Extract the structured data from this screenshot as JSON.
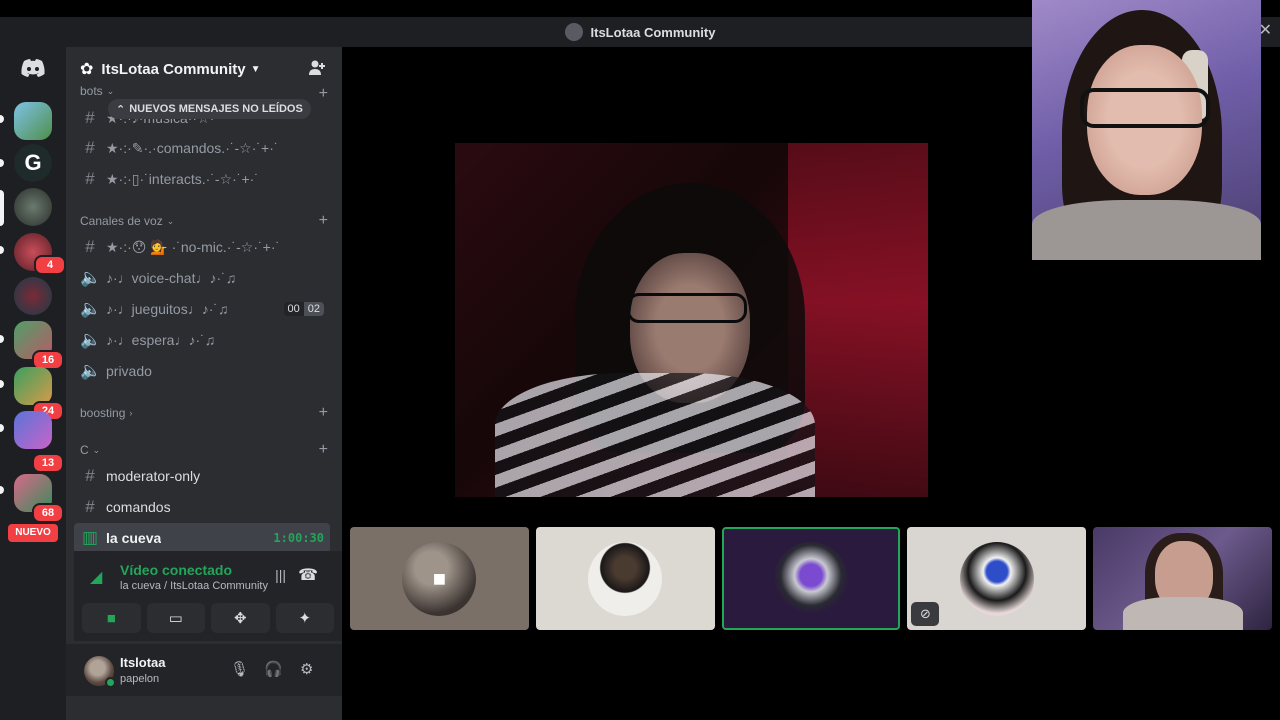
{
  "window": {
    "title": "ItsLotaa Community"
  },
  "rail": {
    "logo": "discord-logo",
    "badges": [
      "4",
      "16",
      "24",
      "13",
      "68"
    ],
    "new_label": "NUEVO"
  },
  "server": {
    "name": "ItsLotaa Community",
    "unread_banner": "NUEVOS MENSAJES NO LEÍDOS"
  },
  "categories": {
    "bots": "bots",
    "voice": "Canales de voz",
    "boosting": "boosting",
    "c": "C"
  },
  "channels": {
    "musica": "★·:·♪·musica··☆·",
    "comandos_top": "★·:·✎·.·comandos.·˙-☆·˙+·˙",
    "interacts": "★·:·▯·˙interacts.·˙-☆·˙+·˙",
    "no_mic": "★·:·😯 💁 ·˙no-mic.·˙-☆·˙+·˙",
    "voice_chat": "♪·♩voice-chat♩♪·˙♫",
    "jueguitos": "♪·♩jueguitos♩♪·˙♫",
    "espera": "♪·♩espera♩♪·˙♫",
    "privado": "privado",
    "moderator_only": "moderator-only",
    "comandos": "comandos",
    "la_cueva": "la cueva"
  },
  "jueguitos_count": {
    "current": "00",
    "limit": "02"
  },
  "la_cueva_timer": "1:00:30",
  "voice": {
    "status": "Vídeo conectado",
    "location": "la cueva / ItsLotaa Community"
  },
  "user": {
    "name": "Itslotaa",
    "status": "papelon"
  },
  "colors": {
    "accent_green": "#23a55a",
    "badge_red": "#f23f43",
    "sidebar": "#2b2d31",
    "rail": "#1e1f22"
  }
}
